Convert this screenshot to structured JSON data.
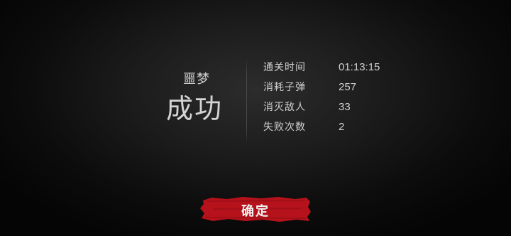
{
  "result": {
    "mode": "噩梦",
    "outcome": "成功"
  },
  "stats": [
    {
      "label": "通关时间",
      "value": "01:13:15"
    },
    {
      "label": "消耗子弹",
      "value": "257"
    },
    {
      "label": "消灭敌人",
      "value": "33"
    },
    {
      "label": "失败次数",
      "value": "2"
    }
  ],
  "confirm": {
    "label": "确定",
    "color": "#b5121b"
  }
}
